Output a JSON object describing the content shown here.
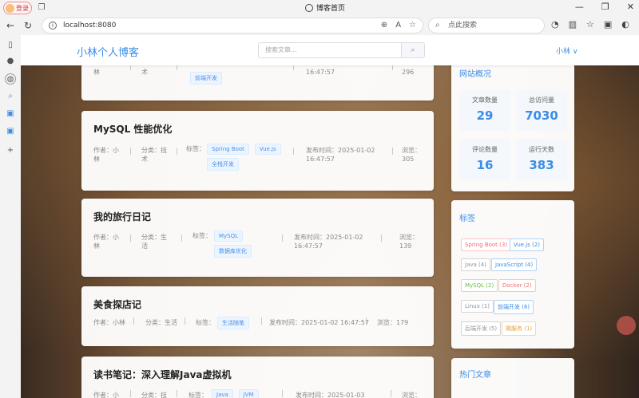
{
  "browser": {
    "profile_label": "登录",
    "tab_title": "博客首页",
    "url": "localhost:8080",
    "search_placeholder": "点此搜索"
  },
  "site": {
    "brand": "小林个人博客",
    "search_placeholder": "搜索文章...",
    "search_button": "⌕",
    "user": "小林 ∨"
  },
  "articles": [
    {
      "title": "",
      "author": "林",
      "category": "术",
      "tags": [
        "前端开发"
      ],
      "date": "16:47:57",
      "views": "296"
    },
    {
      "title": "MySQL 性能优化",
      "author_l1": "作者：小",
      "author_l2": "林",
      "category_l1": "分类：技",
      "category_l2": "术",
      "tags_label": "标签：",
      "tags": [
        "Spring Boot",
        "Vue.js",
        "全栈开发"
      ],
      "date_l1": "发布时间：2025-01-02",
      "date_l2": "16:47:57",
      "views_l1": "浏览：",
      "views_l2": "305"
    },
    {
      "title": "我的旅行日记",
      "author_l1": "作者：小",
      "author_l2": "林",
      "category_l1": "分类：生",
      "category_l2": "活",
      "tags_label": "标签：",
      "tags": [
        "MySQL",
        "数据库优化"
      ],
      "date_l1": "发布时间：2025-01-02",
      "date_l2": "16:47:57",
      "views_l1": "浏览：",
      "views_l2": "139"
    },
    {
      "title": "美食探店记",
      "author": "作者：小林",
      "category": "分类：生活",
      "tags_label": "标签：",
      "tags": [
        "生活随笔"
      ],
      "date": "发布时间：2025-01-02 16:47:57",
      "views": "浏览：179"
    },
    {
      "title": "读书笔记：深入理解Java虚拟机",
      "author": "作者：小",
      "category": "分类：技",
      "tags_label": "标签：",
      "tags": [
        "Java",
        "JVM"
      ],
      "date": "发布时间：2025-01-03",
      "views": "浏览："
    }
  ],
  "overview": {
    "title": "网站概况",
    "stats": [
      {
        "label": "文章数量",
        "value": "29"
      },
      {
        "label": "总访问量",
        "value": "7030"
      },
      {
        "label": "评论数量",
        "value": "16"
      },
      {
        "label": "运行天数",
        "value": "383"
      }
    ]
  },
  "tag_panel": {
    "title": "标签",
    "tags": [
      {
        "label": "Spring Boot (3)",
        "color": "#f56c6c"
      },
      {
        "label": "Vue.js (2)",
        "color": "#3a8ee6"
      },
      {
        "label": "Java (4)",
        "color": "#909399"
      },
      {
        "label": "JavaScript (4)",
        "color": "#3a8ee6"
      },
      {
        "label": "MySQL (2)",
        "color": "#67c23a"
      },
      {
        "label": "Docker (2)",
        "color": "#f56c6c"
      },
      {
        "label": "Linux (1)",
        "color": "#909399"
      },
      {
        "label": "前端开发 (6)",
        "color": "#3a8ee6"
      },
      {
        "label": "后端开发 (5)",
        "color": "#909399"
      },
      {
        "label": "微服务 (1)",
        "color": "#e6a23c"
      }
    ]
  },
  "hot": {
    "title": "热门文章"
  }
}
